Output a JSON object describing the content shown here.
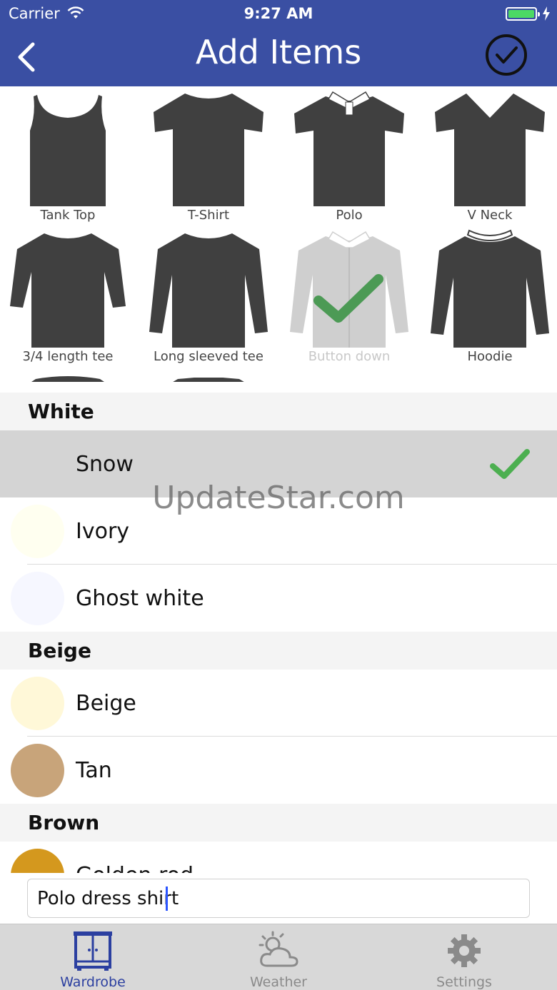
{
  "status_bar": {
    "carrier": "Carrier",
    "time": "9:27 AM"
  },
  "nav": {
    "title": "Add Items"
  },
  "garments": [
    {
      "label": "Tank Top",
      "shape": "tank-top-icon",
      "selected": false
    },
    {
      "label": "T-Shirt",
      "shape": "tshirt-icon",
      "selected": false
    },
    {
      "label": "Polo",
      "shape": "polo-icon",
      "selected": false
    },
    {
      "label": "V Neck",
      "shape": "vneck-icon",
      "selected": false
    },
    {
      "label": "3/4 length tee",
      "shape": "three-quarter-tee-icon",
      "selected": false
    },
    {
      "label": "Long sleeved tee",
      "shape": "long-sleeve-tee-icon",
      "selected": false
    },
    {
      "label": "Button down",
      "shape": "button-down-icon",
      "selected": true
    },
    {
      "label": "Hoodie",
      "shape": "hoodie-icon",
      "selected": false
    }
  ],
  "color_sections": [
    {
      "title": "White",
      "colors": [
        {
          "name": "Snow",
          "swatch": "#fffafa",
          "selected": true
        },
        {
          "name": "Ivory",
          "swatch": "#fffff0",
          "selected": false
        },
        {
          "name": "Ghost white",
          "swatch": "#f8f8ff",
          "selected": false
        }
      ]
    },
    {
      "title": "Beige",
      "colors": [
        {
          "name": "Beige",
          "swatch": "#fff8d8",
          "selected": false
        },
        {
          "name": "Tan",
          "swatch": "#c8a47a",
          "selected": false
        }
      ]
    },
    {
      "title": "Brown",
      "colors": [
        {
          "name": "Golden rod",
          "swatch": "#d4981e",
          "selected": false
        }
      ]
    }
  ],
  "watermark": "UpdateStar.com",
  "item_name_input": {
    "value": "Polo dress shirt"
  },
  "tabs": [
    {
      "label": "Wardrobe",
      "icon": "wardrobe-icon",
      "active": true
    },
    {
      "label": "Weather",
      "icon": "weather-icon",
      "active": false
    },
    {
      "label": "Settings",
      "icon": "gear-icon",
      "active": false
    }
  ],
  "colors": {
    "nav_bar": "#3a4fa3",
    "garment": "#404040",
    "check": "#4caf50",
    "tab_active": "#2b3fa0"
  }
}
